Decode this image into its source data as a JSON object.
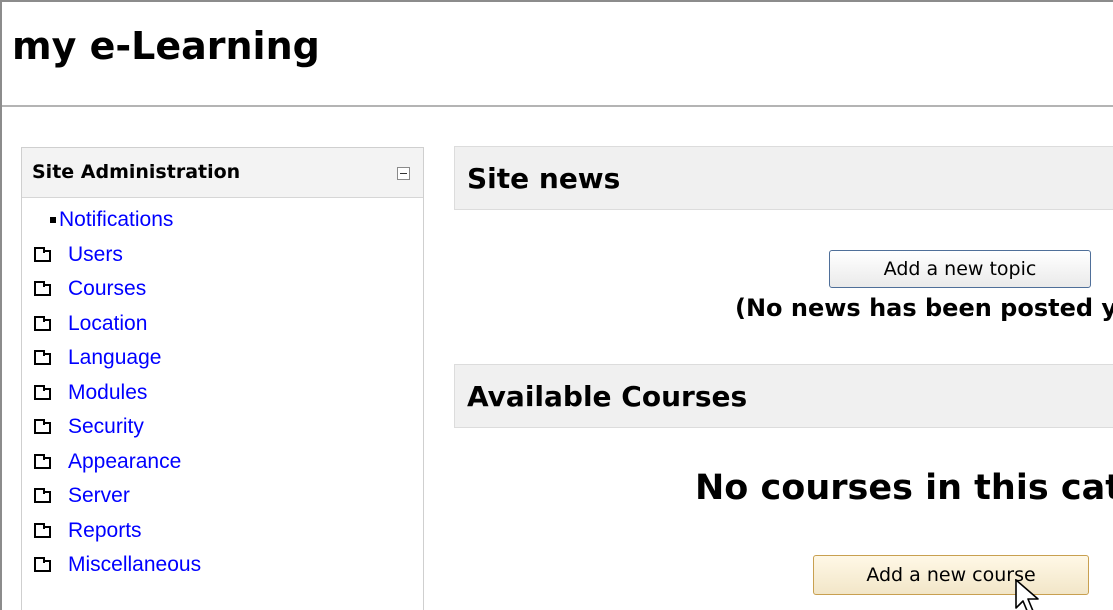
{
  "site": {
    "title": "my e-Learning"
  },
  "admin_block": {
    "title": "Site Administration",
    "collapse_icon": "minus-box-icon",
    "items": [
      {
        "label": "Notifications",
        "icon": "bullet-icon"
      },
      {
        "label": "Users",
        "icon": "folder-icon"
      },
      {
        "label": "Courses",
        "icon": "folder-icon"
      },
      {
        "label": "Location",
        "icon": "folder-icon"
      },
      {
        "label": "Language",
        "icon": "folder-icon"
      },
      {
        "label": "Modules",
        "icon": "folder-icon"
      },
      {
        "label": "Security",
        "icon": "folder-icon"
      },
      {
        "label": "Appearance",
        "icon": "folder-icon"
      },
      {
        "label": "Server",
        "icon": "folder-icon"
      },
      {
        "label": "Reports",
        "icon": "folder-icon"
      },
      {
        "label": "Miscellaneous",
        "icon": "folder-icon"
      }
    ]
  },
  "site_news": {
    "title": "Site news",
    "add_topic_label": "Add a new topic",
    "empty_message": "(No news has been posted yet)"
  },
  "available_courses": {
    "title": "Available Courses",
    "empty_message": "No courses in this category",
    "add_course_label": "Add a new course"
  },
  "colors": {
    "link": "#0000ff",
    "header_background": "#f0f0f0"
  }
}
